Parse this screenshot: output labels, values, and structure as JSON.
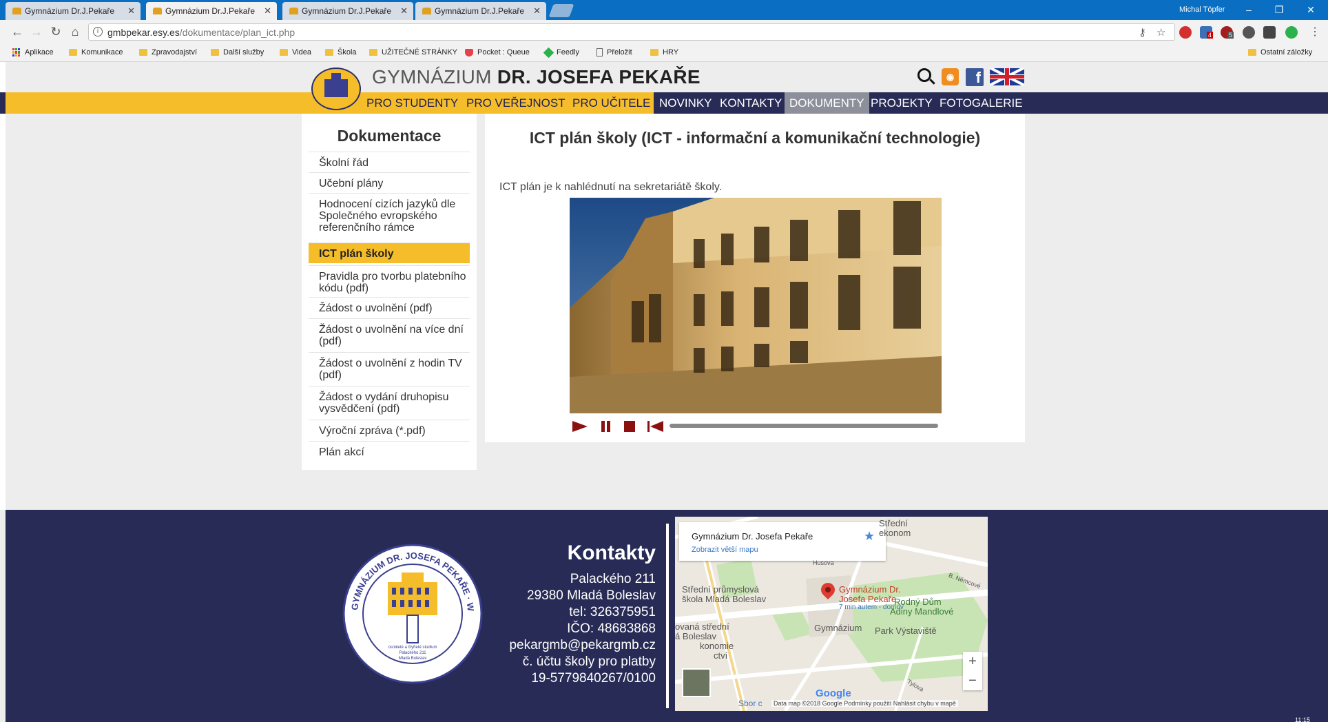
{
  "browser": {
    "tabs": [
      {
        "title": "Gymnázium Dr.J.Pekaře",
        "active": false
      },
      {
        "title": "Gymnázium Dr.J.Pekaře",
        "active": true
      },
      {
        "title": "Gymnázium Dr.J.Pekaře",
        "active": false
      },
      {
        "title": "Gymnázium Dr.J.Pekaře",
        "active": false
      }
    ],
    "close_glyph": "✕",
    "user": "Michal Töpfer",
    "url_host": "gmbpekar.esy.es",
    "url_path": "/dokumentace/plan_ict.php",
    "bookmarks": [
      {
        "label": "Aplikace",
        "icon": "apps-icon"
      },
      {
        "label": "Komunikace",
        "icon": "folder-icon"
      },
      {
        "label": "Zpravodajství",
        "icon": "folder-icon"
      },
      {
        "label": "Další služby",
        "icon": "folder-icon"
      },
      {
        "label": "Videa",
        "icon": "folder-icon"
      },
      {
        "label": "Škola",
        "icon": "folder-icon"
      },
      {
        "label": "UŽITEČNÉ STRÁNKY",
        "icon": "folder-icon"
      },
      {
        "label": "Pocket : Queue",
        "icon": "pocket-icon"
      },
      {
        "label": "Feedly",
        "icon": "feedly-icon"
      },
      {
        "label": "Přeložit",
        "icon": "page-icon"
      },
      {
        "label": "HRY",
        "icon": "folder-icon"
      }
    ],
    "other_bookmarks": "Ostatní záložky",
    "extension_badges": [
      "4",
      "5"
    ]
  },
  "site": {
    "title_light": "GYMNÁZIUM ",
    "title_bold": "DR. JOSEFA PEKAŘE",
    "rss_glyph": "◉",
    "fb_glyph": "f",
    "menu": [
      {
        "label": "PRO STUDENTY",
        "group": "yellow",
        "active": false
      },
      {
        "label": "PRO VEŘEJNOST",
        "group": "yellow",
        "active": false
      },
      {
        "label": "PRO UČITELE",
        "group": "yellow",
        "active": false
      },
      {
        "label": "NOVINKY",
        "group": "dark",
        "active": false
      },
      {
        "label": "KONTAKTY",
        "group": "dark",
        "active": false
      },
      {
        "label": "DOKUMENTY",
        "group": "dark",
        "active": true
      },
      {
        "label": "PROJEKTY",
        "group": "dark",
        "active": false
      },
      {
        "label": "FOTOGALERIE",
        "group": "dark",
        "active": false
      }
    ],
    "colors": {
      "accent": "#f6bd2a",
      "navy": "#272b55",
      "active_menu": "#8d8f9a"
    }
  },
  "sidebar": {
    "title": "Dokumentace",
    "items": [
      {
        "label": "Školní řád",
        "active": false
      },
      {
        "label": "Učební plány",
        "active": false
      },
      {
        "label": "Hodnocení cizích jazyků dle Společného evropského referenčního rámce",
        "active": false
      },
      {
        "label": "ICT plán školy",
        "active": true
      },
      {
        "label": "Pravidla pro tvorbu platebního kódu (pdf)",
        "active": false
      },
      {
        "label": "Žádost o uvolnění (pdf)",
        "active": false
      },
      {
        "label": "Žádost o uvolnění na více dní (pdf)",
        "active": false
      },
      {
        "label": "Žádost o uvolnění z hodin TV (pdf)",
        "active": false
      },
      {
        "label": "Žádost o vydání druhopisu vysvědčení (pdf)",
        "active": false
      },
      {
        "label": "Výroční zpráva (*.pdf)",
        "active": false
      },
      {
        "label": "Plán akcí",
        "active": false
      }
    ]
  },
  "content": {
    "title": "ICT plán školy (ICT - informační a komunikační technologie)",
    "text": "ICT plán je k nahlédnutí na sekretariátě školy.",
    "player": {
      "progress": 0
    }
  },
  "footer": {
    "heading": "Kontakty",
    "lines": [
      "Palackého 211",
      "29380 Mladá Boleslav",
      "tel: 326375951",
      "IČO: 48683868",
      "pekargmb@pekargmb.cz",
      "č. účtu školy pro platby",
      "19-5779840267/0100"
    ],
    "logo": {
      "ring_text": "GYMNÁZIUM DR. JOSEFA PEKAŘE · WWW.PEKARGMB.CZ",
      "inner_lines": [
        "osmileté a čtyřleté studium",
        "Palackého 211",
        "Mladá Boleslav"
      ]
    },
    "map": {
      "card_title": "Gymnázium Dr. Josefa Pekaře",
      "card_link": "Zobrazit větší mapu",
      "pin_label_1": "Gymnázium Dr.",
      "pin_label_2": "Josefa Pekaře",
      "pin_sub": "7 min autem - domov",
      "labels": [
        {
          "text": "Střední",
          "kind": "plain"
        },
        {
          "text": "ekonom",
          "kind": "plain"
        },
        {
          "text": "Střední průmyslová",
          "kind": "plain"
        },
        {
          "text": "škola Mladá Boleslav",
          "kind": "plain"
        },
        {
          "text": "Rodný Dům",
          "kind": "green"
        },
        {
          "text": "Adiny Mandlové",
          "kind": "green"
        },
        {
          "text": "Gymnázium",
          "kind": "plain"
        },
        {
          "text": "Park Výstaviště",
          "kind": "plain"
        },
        {
          "text": "ovaná střední",
          "kind": "plain"
        },
        {
          "text": "á Boleslav",
          "kind": "plain"
        },
        {
          "text": "konomie",
          "kind": "plain"
        },
        {
          "text": "ctví",
          "kind": "plain"
        },
        {
          "text": "Husova",
          "kind": "plain"
        },
        {
          "text": "B. Němcové",
          "kind": "plain"
        },
        {
          "text": "Tylova",
          "kind": "plain"
        }
      ],
      "zoom_in": "+",
      "zoom_out": "−",
      "google": "Google",
      "bottom_left": "Sbor c",
      "attribution": "Data map ©2018 Google    Podmínky použití    Nahlásit chybu v mapě"
    }
  },
  "taskbar": {
    "clock": "11:15"
  }
}
